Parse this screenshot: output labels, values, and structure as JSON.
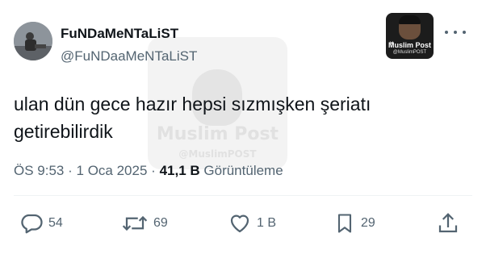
{
  "watermark": {
    "title": "Muslim Post",
    "handle": "@MuslimPOST"
  },
  "header": {
    "display_name": "FuNDaMeNTaLiST",
    "handle": "@FuNDaaMeNTaLiST"
  },
  "badge": {
    "title": "Muslim Post",
    "handle": "@MuslimPOST"
  },
  "tweet": {
    "text_line1": "ulan dün gece hazır hepsi sızmışken şeriatı",
    "text_line2": "getirebilirdik"
  },
  "meta": {
    "time": "ÖS 9:53",
    "date": "1 Oca 2025",
    "views_count": "41,1 B",
    "views_label": "Görüntüleme",
    "separator": "·"
  },
  "actions": {
    "replies": "54",
    "reposts": "69",
    "likes": "1 B",
    "bookmarks": "29"
  },
  "icons": {
    "reply": "reply-icon",
    "repost": "repost-icon",
    "like": "heart-icon",
    "bookmark": "bookmark-icon",
    "share": "share-icon",
    "more": "more-icon"
  },
  "colors": {
    "text": "#0f1419",
    "secondary": "#536471",
    "divider": "#eff3f4"
  }
}
